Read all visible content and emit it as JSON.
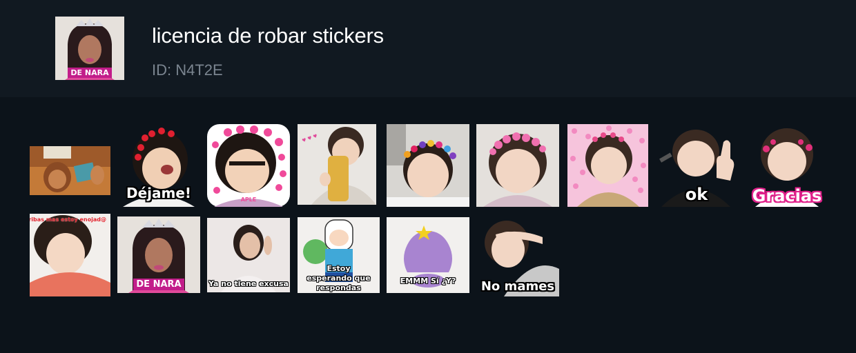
{
  "pack": {
    "title": "licencia de robar stickers",
    "id_label": "ID: N4T2E",
    "thumbnail_caption": "DE NARA"
  },
  "stickers": [
    {
      "name": "sticker-emperor-kuzco",
      "caption": ""
    },
    {
      "name": "sticker-dejame",
      "caption": "Déjame!"
    },
    {
      "name": "sticker-heart-eyes",
      "caption": "APLE"
    },
    {
      "name": "sticker-phone-baby",
      "caption": ""
    },
    {
      "name": "sticker-flower-crown-bath",
      "caption": ""
    },
    {
      "name": "sticker-flower-crown",
      "caption": ""
    },
    {
      "name": "sticker-pink-hearts",
      "caption": ""
    },
    {
      "name": "sticker-ok",
      "caption": "ok"
    },
    {
      "name": "sticker-gracias",
      "caption": "Gracias"
    },
    {
      "name": "sticker-no-escribas",
      "caption": "no escribas mas estoy enojad@"
    },
    {
      "name": "sticker-de-nara",
      "caption": "DE NARA"
    },
    {
      "name": "sticker-ya-no-tiene-excusa",
      "caption": "Ya no tiene excusa"
    },
    {
      "name": "sticker-estoy-esperando",
      "caption": "Estoy esperando que respondas"
    },
    {
      "name": "sticker-emmm-si-y",
      "caption": "EMMM Sí ¿Y?"
    },
    {
      "name": "sticker-no-mames",
      "caption": "No mames"
    }
  ],
  "colors": {
    "background": "#0c131a",
    "header": "#111921",
    "title": "#ffffff",
    "id": "#7b8590"
  }
}
